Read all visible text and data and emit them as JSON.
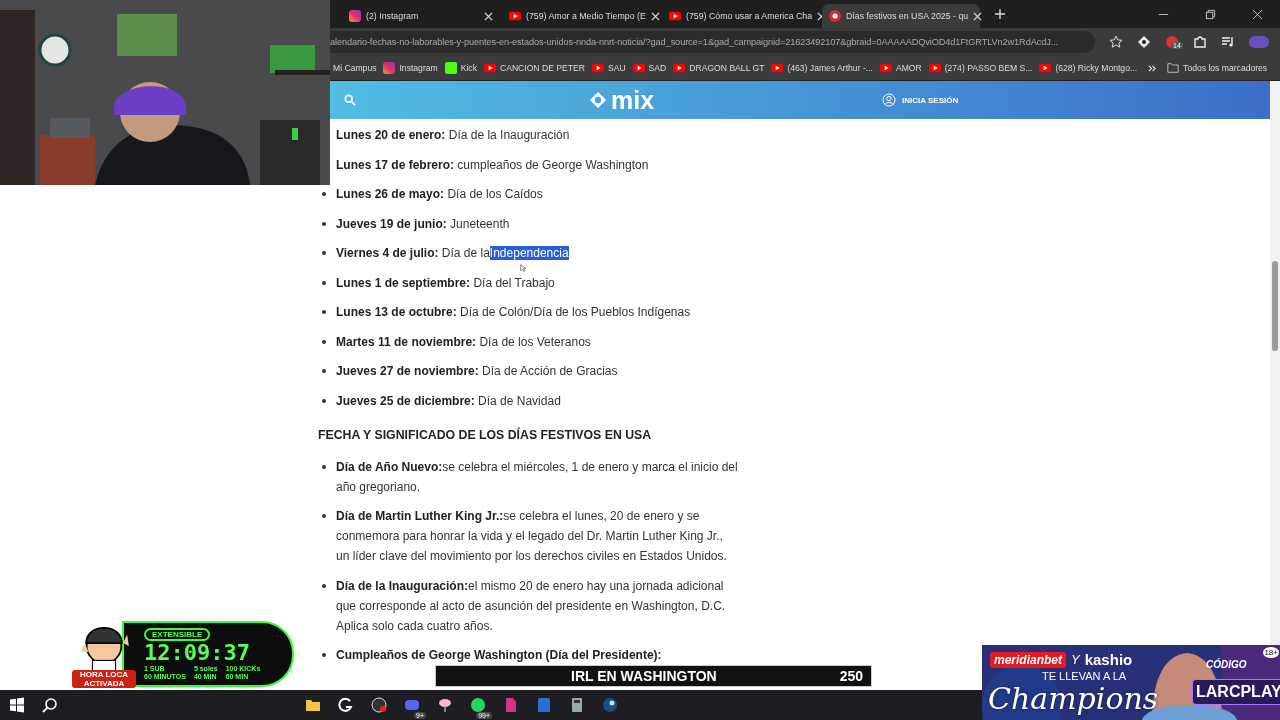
{
  "browser": {
    "tabs": [
      {
        "title": "(2) Instagram",
        "kind": "instagram",
        "selected": false
      },
      {
        "title": "(759) Amor a Medio Tiempo (E",
        "kind": "youtube",
        "selected": false
      },
      {
        "title": "(759) Cómo usar a America Cha",
        "kind": "youtube",
        "selected": false
      },
      {
        "title": "Días festivos en USA 2025 - qu",
        "kind": "site",
        "selected": true
      }
    ],
    "address": "alendario-fechas-no-laborables-y-puentes-en-estados-unidos-nnda-nnrt-noticia/?gad_source=1&gad_campaignid=21623492107&gbraid=0AAAAADQviOD4d1FtGRTLVn2w1RdAcdJ...",
    "extension_badge": "14",
    "bookmarks": [
      {
        "label": "Mi Campus",
        "kind": "plain"
      },
      {
        "label": "Instagram",
        "kind": "instagram"
      },
      {
        "label": "Kick",
        "kind": "kick"
      },
      {
        "label": "CANCION DE PETER",
        "kind": "youtube"
      },
      {
        "label": "SAU",
        "kind": "youtube"
      },
      {
        "label": "SAD",
        "kind": "youtube"
      },
      {
        "label": "DRAGON BALL GT",
        "kind": "youtube"
      },
      {
        "label": "(463) James Arthur -...",
        "kind": "youtube"
      },
      {
        "label": "AMOR",
        "kind": "youtube"
      },
      {
        "label": "(274) PASSO BEM S...",
        "kind": "youtube"
      },
      {
        "label": "(628) Ricky Montgo...",
        "kind": "youtube"
      }
    ],
    "all_bookmarks": "Todos los marcadores"
  },
  "site": {
    "logo": "mix",
    "login": "INICIA SESIÓN",
    "holidays": [
      {
        "label": "Lunes 20 de enero:",
        "text": "Día de la Inauguración"
      },
      {
        "label": "Lunes 17 de febrero:",
        "text": "cumpleaños de George Washington"
      },
      {
        "label": "Lunes 26 de mayo:",
        "text": "Día de los Caídos"
      },
      {
        "label": "Jueves 19 de junio:",
        "text": "Juneteenth"
      },
      {
        "label": "Viernes 4 de julio:",
        "text": "Día de la",
        "selected_text": "Independencia"
      },
      {
        "label": "Lunes 1 de septiembre:",
        "text": "Día del Trabajo"
      },
      {
        "label": "Lunes 13 de octubre:",
        "text": "Día de Colón/Día de los Pueblos Indígenas"
      },
      {
        "label": "Martes 11 de noviembre:",
        "text": "Día de los Veteranos"
      },
      {
        "label": "Jueves 27 de noviembre:",
        "text": "Día de Acción de Gracias"
      },
      {
        "label": "Jueves 25 de diciembre:",
        "text": "Día de Navidad"
      }
    ],
    "heading": "FECHA Y SIGNIFICADO DE LOS DÍAS FESTIVOS EN USA",
    "meanings": [
      {
        "label": "Día de Año Nuevo:",
        "text": "se celebra el miércoles, 1 de enero y marca el inicio del año gregoriano."
      },
      {
        "label": "Día de Martin Luther King Jr.:",
        "text": "se celebra el lunes, 20 de enero y se conmemora para honrar la vida y el legado del Dr. Martin Luther King Jr., un líder clave del movimiento por los derechos civiles en Estados Unidos."
      },
      {
        "label": "Día de la Inauguración:",
        "text": "el mismo 20 de enero hay una jornada adicional que corresponde al acto de asunción del presidente en Washington, D.C. Aplica solo cada cuatro años."
      },
      {
        "label": "Cumpleaños de George Washington (Día del Presidente):"
      }
    ]
  },
  "timer": {
    "tag": "EXTENSIBLE",
    "time": "12:09:37",
    "stamp": "HORA LOCA ACTIVADA",
    "rules": [
      {
        "top": "1 SUB",
        "bottom": "60 MINUTOS"
      },
      {
        "top": "5 soles",
        "bottom": "40 MIN"
      },
      {
        "top": "100 KICKs",
        "bottom": "60 MIN"
      }
    ]
  },
  "ad": {
    "brand": "meridianbet",
    "joiner": "Y",
    "partner": "kashio",
    "line": "TE LLEVAN A LA",
    "title": "Champions",
    "code_label": "CÓDIGO",
    "code": "LARCPLAY",
    "age": "18+"
  },
  "banner": {
    "title": "IRL EN WASHINGTON",
    "count": "250"
  },
  "taskbar": [
    {
      "kind": "windows"
    },
    {
      "kind": "search"
    },
    {
      "kind": "folder"
    },
    {
      "kind": "g"
    },
    {
      "kind": "obs"
    },
    {
      "kind": "discord",
      "badge": "9+"
    },
    {
      "kind": "app"
    },
    {
      "kind": "whatsapp",
      "badge": "99+"
    },
    {
      "kind": "pink"
    },
    {
      "kind": "word"
    },
    {
      "kind": "calc"
    },
    {
      "kind": "steam"
    }
  ]
}
